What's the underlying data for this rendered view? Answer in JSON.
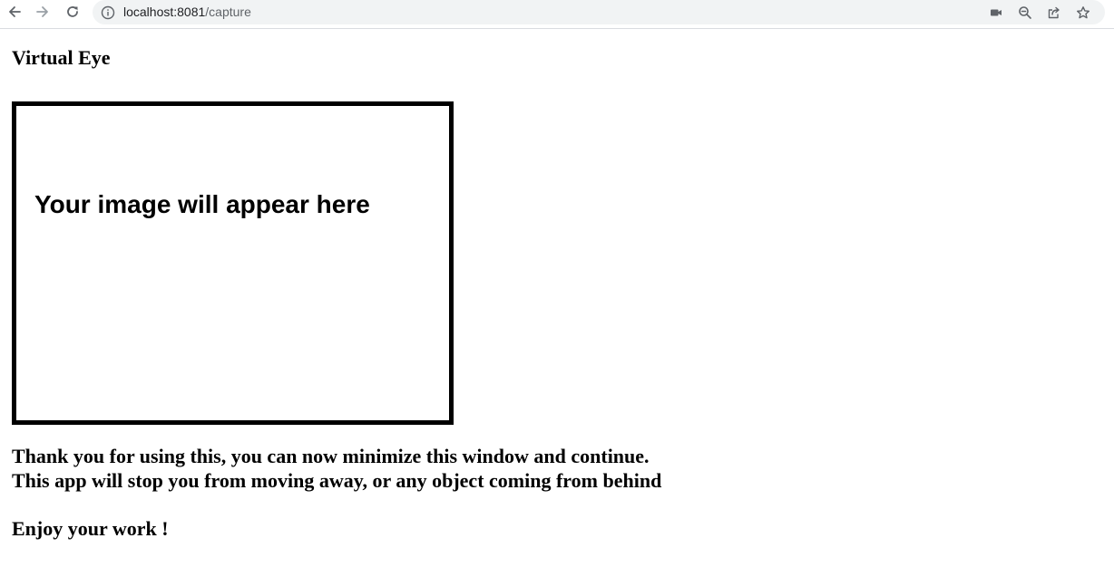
{
  "browser": {
    "url_host": "localhost:8081",
    "url_path": "/capture",
    "icons": {
      "back": "arrow-left-icon",
      "forward": "arrow-right-icon",
      "reload": "reload-icon",
      "site_info": "info-icon",
      "camera": "camera-icon",
      "zoom": "zoom-icon",
      "share": "share-icon",
      "bookmark": "star-icon"
    }
  },
  "page": {
    "title": "Virtual Eye",
    "image_placeholder": "Your image will appear here",
    "message_line1": "Thank you for using this, you can now minimize this window and continue.",
    "message_line2": "This app will stop you from moving away, or any object coming from behind",
    "enjoy": "Enjoy your work !"
  }
}
